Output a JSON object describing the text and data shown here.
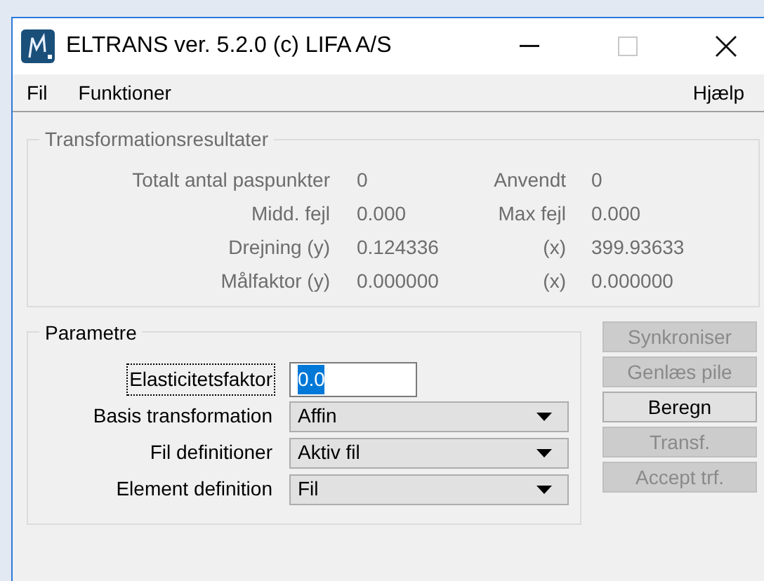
{
  "window": {
    "title": "ELTRANS ver. 5.2.0 (c) LIFA A/S",
    "controls": [
      {
        "kind": "minimize",
        "disabled": false
      },
      {
        "kind": "maximize",
        "disabled": true
      },
      {
        "kind": "close",
        "disabled": false
      }
    ]
  },
  "menu": {
    "left": [
      {
        "label": "Fil"
      },
      {
        "label": "Funktioner"
      }
    ],
    "right": [
      {
        "label": "Hjælp"
      }
    ]
  },
  "results": {
    "title": "Transformationsresultater",
    "disabled": true,
    "rows": [
      {
        "label": "Totalt antal paspunkter",
        "value": "0",
        "label2": "Anvendt",
        "value2": "0"
      },
      {
        "label": "Midd. fejl",
        "value": "0.000",
        "label2": "Max fejl",
        "value2": "0.000"
      },
      {
        "label": "Drejning (y)",
        "value": "0.124336",
        "label2": "(x)",
        "value2": "399.93633"
      },
      {
        "label": "Målfaktor (y)",
        "value": "0.000000",
        "label2": "(x)",
        "value2": "0.000000"
      }
    ]
  },
  "params": {
    "title": "Parametre",
    "fields": [
      {
        "kind": "text",
        "label": "Elasticitetsfaktor",
        "value": "0.0",
        "focused": true
      },
      {
        "kind": "dropdown",
        "label": "Basis transformation",
        "value": "Affin",
        "focused": false
      },
      {
        "kind": "dropdown",
        "label": "Fil definitioner",
        "value": "Aktiv fil",
        "focused": false
      },
      {
        "kind": "dropdown",
        "label": "Element definition",
        "value": "Fil",
        "focused": false
      }
    ]
  },
  "buttons": [
    {
      "label": "Synkroniser",
      "disabled": true
    },
    {
      "label": "Genlæs pile",
      "disabled": true
    },
    {
      "label": "Beregn",
      "disabled": false
    },
    {
      "label": "Transf.",
      "disabled": true
    },
    {
      "label": "Accept trf.",
      "disabled": true
    }
  ]
}
